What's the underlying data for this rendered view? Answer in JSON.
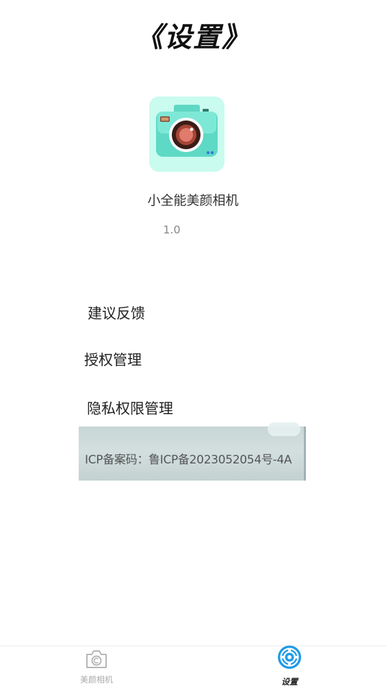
{
  "header": {
    "title": "《设置》"
  },
  "app": {
    "icon": "camera-icon",
    "name": "小全能美颜相机",
    "version": "1.0"
  },
  "menu": {
    "items": [
      {
        "label": "建议反馈"
      },
      {
        "label": "授权管理"
      },
      {
        "label": "隐私权限管理"
      }
    ]
  },
  "icp": {
    "text": "ICP备案码：鲁ICP备2023052054号-4A"
  },
  "tabbar": {
    "tabs": [
      {
        "label": "美颜相机",
        "icon": "camera-outline-icon",
        "active": false
      },
      {
        "label": "设置",
        "icon": "gear-icon",
        "active": true
      }
    ]
  },
  "colors": {
    "accent": "#1e9be8",
    "app_icon_bg": "#c9fbee",
    "inactive_tab": "#aaaaaa"
  }
}
